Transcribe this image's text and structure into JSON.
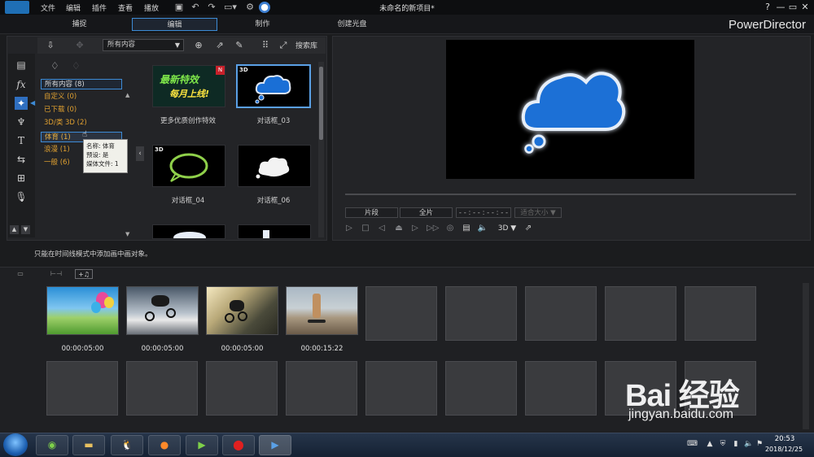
{
  "titlebar": {
    "menu": [
      "文件",
      "编辑",
      "插件",
      "查看",
      "播放"
    ],
    "title": "未命名的新项目*",
    "window_controls": [
      "?",
      "—",
      "▭",
      "✕"
    ]
  },
  "modes": {
    "tabs": [
      "捕捉",
      "编辑",
      "制作",
      "创建光盘"
    ],
    "active": "编辑",
    "brand": "PowerDirector"
  },
  "library": {
    "filter": "所有内容",
    "search_label": "搜索库",
    "categories": [
      {
        "label": "所有内容 (8)",
        "selected": false,
        "highlight": true
      },
      {
        "label": "自定义 (0)",
        "selected": false
      },
      {
        "label": "已下载 (0)",
        "selected": false
      },
      {
        "label": "3D/类 3D (2)",
        "selected": false
      },
      {
        "label": "体育 (1)",
        "selected": true
      },
      {
        "label": "浪漫 (1)",
        "selected": false
      },
      {
        "label": "一般 (6)",
        "selected": false
      }
    ],
    "tooltip": [
      "名称: 体育",
      "预设: 是",
      "媒体文件: 1"
    ],
    "items": [
      {
        "label": "更多优质创作特效",
        "promo_line1": "最新特效",
        "promo_line2": "每月上线!",
        "badge": "N"
      },
      {
        "label": "对话框_03",
        "badge": "3D"
      },
      {
        "label": "对话框_04",
        "badge": "3D"
      },
      {
        "label": "对话框_06",
        "badge": ""
      }
    ]
  },
  "preview": {
    "clip_button": "片段",
    "full_button": "全片",
    "timecode": "- - : - - : - - : - -",
    "fit_label": "适合大小 ▼",
    "mode_3d": "3D ▼"
  },
  "message": "只能在时间线模式中添加画中画对象。",
  "storyboard": {
    "clips": [
      {
        "duration": "00:00:05:00"
      },
      {
        "duration": "00:00:05:00"
      },
      {
        "duration": "00:00:05:00"
      },
      {
        "duration": "00:00:15:22"
      }
    ]
  },
  "taskbar": {
    "time": "20:53",
    "date": "2018/12/25"
  },
  "watermark": {
    "logo": "Bai 经验",
    "url": "jingyan.baidu.com"
  },
  "colors": {
    "accent": "#3d8bd6",
    "category_text": "#e0a030",
    "cloud_blue": "#1a6fd6"
  }
}
